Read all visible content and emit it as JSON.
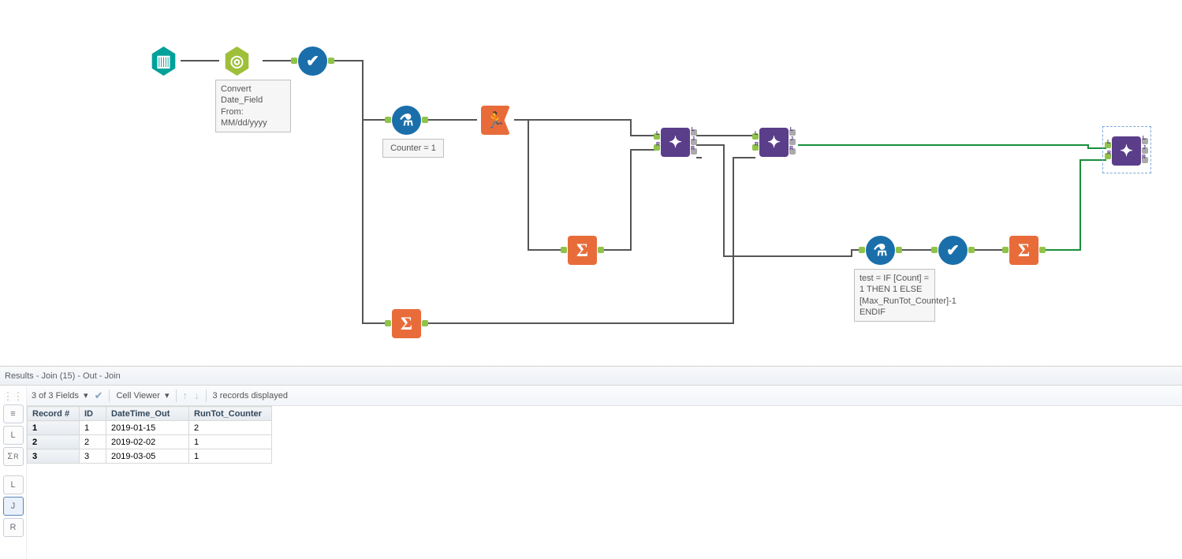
{
  "canvas": {
    "tools": {
      "datetime_convert": {
        "annotation": "Convert\nDate_Field From:\nMM/dd/yyyy"
      },
      "formula1": {
        "annotation": "Counter = 1"
      },
      "formula2": {
        "annotation": "test = IF [Count] = 1 THEN 1 ELSE [Max_RunTot_Counter]-1 ENDIF"
      }
    },
    "join_ports": {
      "left": "L",
      "join": "J",
      "right": "R"
    }
  },
  "results": {
    "header": "Results - Join (15) - Out - Join",
    "toolbar": {
      "fields_label": "3 of 3 Fields",
      "cell_viewer": "Cell Viewer",
      "records_displayed": "3 records displayed"
    },
    "columns": [
      "Record #",
      "ID",
      "DateTime_Out",
      "RunTot_Counter"
    ],
    "rows": [
      {
        "record": "1",
        "id": "1",
        "dt": "2019-01-15",
        "ct": "2"
      },
      {
        "record": "2",
        "id": "2",
        "dt": "2019-02-02",
        "ct": "1"
      },
      {
        "record": "3",
        "id": "3",
        "dt": "2019-03-05",
        "ct": "1"
      }
    ],
    "side_icons": {
      "sigma1": "Σ",
      "L": "L",
      "sigma2": "Σ",
      "R": "R",
      "Lb": "L",
      "J": "J",
      "Rb": "R"
    }
  }
}
